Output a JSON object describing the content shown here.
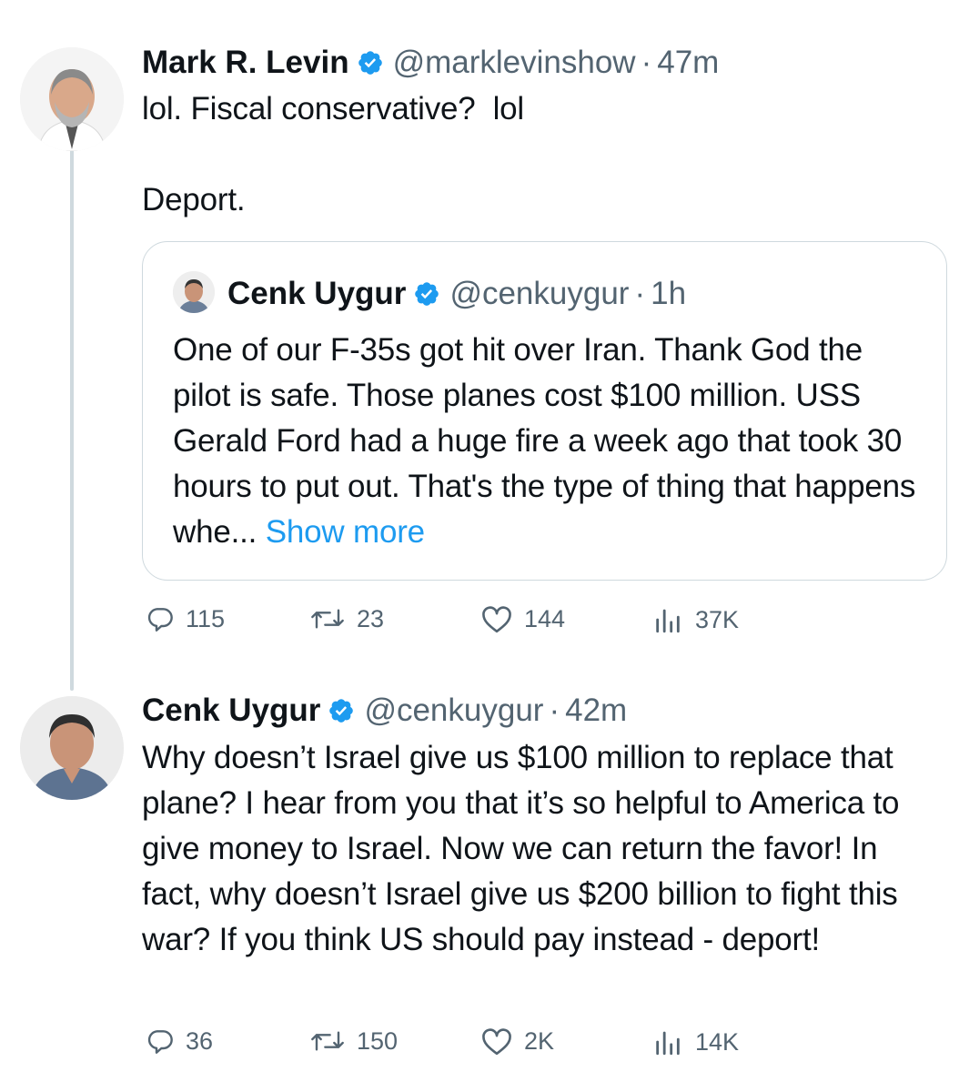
{
  "tweet1": {
    "name": "Mark R. Levin",
    "handle": "@marklevinshow",
    "separator": "·",
    "time": "47m",
    "text": "lol. Fiscal conservative?  lol\n\nDeport.",
    "actions": {
      "replies": "115",
      "reposts": "23",
      "likes": "144",
      "views": "37K"
    }
  },
  "quote": {
    "name": "Cenk Uygur",
    "handle": "@cenkuygur",
    "separator": "·",
    "time": "1h",
    "text": "One of our F-35s got hit over Iran. Thank God the pilot is safe. Those planes cost $100 million. USS Gerald Ford had a huge fire a week ago that took 30 hours to put out. That's the type of thing that happens whe...",
    "show_more": "Show more"
  },
  "tweet2": {
    "name": "Cenk Uygur",
    "handle": "@cenkuygur",
    "separator": "·",
    "time": "42m",
    "text": "Why doesn’t Israel give us $100 million to replace that plane? I hear from you that it’s so helpful to America to give money to Israel. Now we can return the favor! In fact, why doesn’t Israel give us $200 billion to fight this war? If you think US should pay instead - deport!",
    "actions": {
      "replies": "36",
      "reposts": "150",
      "likes": "2K",
      "views": "14K"
    }
  },
  "colors": {
    "text": "#0f1419",
    "secondary": "#536471",
    "link": "#1d9bf0",
    "verified": "#1d9bf0",
    "border": "#cfd9de"
  },
  "icons": [
    "verified-badge-icon",
    "reply-icon",
    "repost-icon",
    "like-icon",
    "views-icon"
  ]
}
